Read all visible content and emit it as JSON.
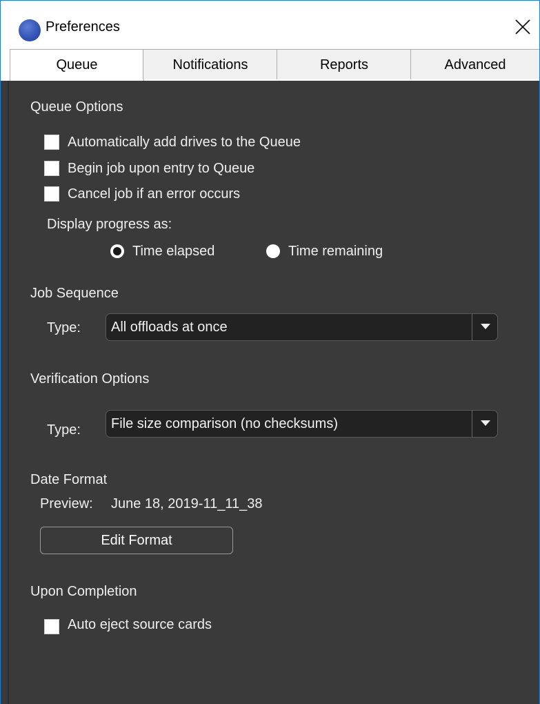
{
  "window": {
    "title": "Preferences",
    "icon": "app-icon",
    "close_icon": "close-icon"
  },
  "tabs": [
    {
      "label": "Queue",
      "active": true
    },
    {
      "label": "Notifications",
      "active": false
    },
    {
      "label": "Reports",
      "active": false
    },
    {
      "label": "Advanced",
      "active": false
    }
  ],
  "queue_options": {
    "heading": "Queue Options",
    "checkboxes": [
      {
        "label": "Automatically add drives to the Queue",
        "checked": false
      },
      {
        "label": "Begin job upon entry to Queue",
        "checked": false
      },
      {
        "label": "Cancel job if an error occurs",
        "checked": false
      }
    ],
    "progress_label": "Display progress as:",
    "progress_options": [
      {
        "label": "Time elapsed",
        "selected": true
      },
      {
        "label": "Time remaining",
        "selected": false
      }
    ]
  },
  "job_sequence": {
    "heading": "Job Sequence",
    "type_label": "Type:",
    "type_value": "All offloads at once"
  },
  "verification_options": {
    "heading": "Verification Options",
    "type_label": "Type:",
    "type_value": "File size comparison (no checksums)"
  },
  "date_format": {
    "heading": "Date Format",
    "preview_label": "Preview:",
    "preview_value": "June 18, 2019-11_11_38",
    "edit_button": "Edit Format"
  },
  "upon_completion": {
    "heading": "Upon Completion",
    "checkboxes": [
      {
        "label": "Auto eject source cards",
        "checked": false
      }
    ]
  },
  "colors": {
    "panel_background": "#3a3a3a",
    "window_border": "#1f7ed6",
    "dropdown_background": "#222222"
  }
}
